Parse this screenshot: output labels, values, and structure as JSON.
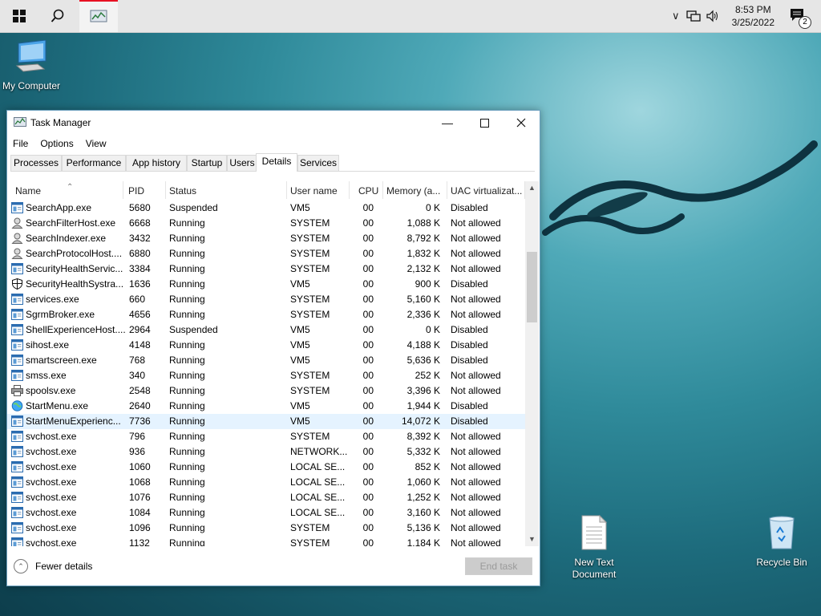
{
  "taskbar": {
    "start_icon": "windows-logo-icon",
    "search_icon": "search-icon",
    "active_app_icon": "task-manager-icon",
    "tray_chevron": "chevron-up-icon",
    "network_icon": "network-icon",
    "volume_icon": "volume-icon",
    "time": "8:53 PM",
    "date": "3/25/2022",
    "notifications_count": "2"
  },
  "desktop": {
    "icons": [
      {
        "label": "My Computer",
        "icon": "computer-icon"
      },
      {
        "label": "New Text Document",
        "label_line1": "New Text",
        "label_line2": "Document",
        "icon": "text-file-icon"
      },
      {
        "label": "Recycle Bin",
        "icon": "recycle-bin-icon"
      }
    ]
  },
  "window": {
    "title": "Task Manager",
    "menu": [
      "File",
      "Options",
      "View"
    ],
    "tabs": [
      "Processes",
      "Performance",
      "App history",
      "Startup",
      "Users",
      "Details",
      "Services"
    ],
    "active_tab": "Details",
    "columns": [
      "Name",
      "PID",
      "Status",
      "User name",
      "CPU",
      "Memory (a...",
      "UAC virtualizat..."
    ],
    "rows": [
      {
        "name": "SearchApp.exe",
        "pid": "5680",
        "status": "Suspended",
        "user": "VM5",
        "cpu": "00",
        "mem": "0 K",
        "uac": "Disabled",
        "icon": "app"
      },
      {
        "name": "SearchFilterHost.exe",
        "pid": "6668",
        "status": "Running",
        "user": "SYSTEM",
        "cpu": "00",
        "mem": "1,088 K",
        "uac": "Not allowed",
        "icon": "search"
      },
      {
        "name": "SearchIndexer.exe",
        "pid": "3432",
        "status": "Running",
        "user": "SYSTEM",
        "cpu": "00",
        "mem": "8,792 K",
        "uac": "Not allowed",
        "icon": "search"
      },
      {
        "name": "SearchProtocolHost....",
        "pid": "6880",
        "status": "Running",
        "user": "SYSTEM",
        "cpu": "00",
        "mem": "1,832 K",
        "uac": "Not allowed",
        "icon": "search"
      },
      {
        "name": "SecurityHealthServic...",
        "pid": "3384",
        "status": "Running",
        "user": "SYSTEM",
        "cpu": "00",
        "mem": "2,132 K",
        "uac": "Not allowed",
        "icon": "app"
      },
      {
        "name": "SecurityHealthSystra...",
        "pid": "1636",
        "status": "Running",
        "user": "VM5",
        "cpu": "00",
        "mem": "900 K",
        "uac": "Disabled",
        "icon": "shield"
      },
      {
        "name": "services.exe",
        "pid": "660",
        "status": "Running",
        "user": "SYSTEM",
        "cpu": "00",
        "mem": "5,160 K",
        "uac": "Not allowed",
        "icon": "app"
      },
      {
        "name": "SgrmBroker.exe",
        "pid": "4656",
        "status": "Running",
        "user": "SYSTEM",
        "cpu": "00",
        "mem": "2,336 K",
        "uac": "Not allowed",
        "icon": "app"
      },
      {
        "name": "ShellExperienceHost....",
        "pid": "2964",
        "status": "Suspended",
        "user": "VM5",
        "cpu": "00",
        "mem": "0 K",
        "uac": "Disabled",
        "icon": "app"
      },
      {
        "name": "sihost.exe",
        "pid": "4148",
        "status": "Running",
        "user": "VM5",
        "cpu": "00",
        "mem": "4,188 K",
        "uac": "Disabled",
        "icon": "app"
      },
      {
        "name": "smartscreen.exe",
        "pid": "768",
        "status": "Running",
        "user": "VM5",
        "cpu": "00",
        "mem": "5,636 K",
        "uac": "Disabled",
        "icon": "app"
      },
      {
        "name": "smss.exe",
        "pid": "340",
        "status": "Running",
        "user": "SYSTEM",
        "cpu": "00",
        "mem": "252 K",
        "uac": "Not allowed",
        "icon": "app"
      },
      {
        "name": "spoolsv.exe",
        "pid": "2548",
        "status": "Running",
        "user": "SYSTEM",
        "cpu": "00",
        "mem": "3,396 K",
        "uac": "Not allowed",
        "icon": "printer"
      },
      {
        "name": "StartMenu.exe",
        "pid": "2640",
        "status": "Running",
        "user": "VM5",
        "cpu": "00",
        "mem": "1,944 K",
        "uac": "Disabled",
        "icon": "globe"
      },
      {
        "name": "StartMenuExperienc...",
        "pid": "7736",
        "status": "Running",
        "user": "VM5",
        "cpu": "00",
        "mem": "14,072 K",
        "uac": "Disabled",
        "icon": "app",
        "selected": true
      },
      {
        "name": "svchost.exe",
        "pid": "796",
        "status": "Running",
        "user": "SYSTEM",
        "cpu": "00",
        "mem": "8,392 K",
        "uac": "Not allowed",
        "icon": "app"
      },
      {
        "name": "svchost.exe",
        "pid": "936",
        "status": "Running",
        "user": "NETWORK...",
        "cpu": "00",
        "mem": "5,332 K",
        "uac": "Not allowed",
        "icon": "app"
      },
      {
        "name": "svchost.exe",
        "pid": "1060",
        "status": "Running",
        "user": "LOCAL SE...",
        "cpu": "00",
        "mem": "852 K",
        "uac": "Not allowed",
        "icon": "app"
      },
      {
        "name": "svchost.exe",
        "pid": "1068",
        "status": "Running",
        "user": "LOCAL SE...",
        "cpu": "00",
        "mem": "1,060 K",
        "uac": "Not allowed",
        "icon": "app"
      },
      {
        "name": "svchost.exe",
        "pid": "1076",
        "status": "Running",
        "user": "LOCAL SE...",
        "cpu": "00",
        "mem": "1,252 K",
        "uac": "Not allowed",
        "icon": "app"
      },
      {
        "name": "svchost.exe",
        "pid": "1084",
        "status": "Running",
        "user": "LOCAL SE...",
        "cpu": "00",
        "mem": "3,160 K",
        "uac": "Not allowed",
        "icon": "app"
      },
      {
        "name": "svchost.exe",
        "pid": "1096",
        "status": "Running",
        "user": "SYSTEM",
        "cpu": "00",
        "mem": "5,136 K",
        "uac": "Not allowed",
        "icon": "app"
      },
      {
        "name": "svchost.exe",
        "pid": "1132",
        "status": "Running",
        "user": "SYSTEM",
        "cpu": "00",
        "mem": "1,184 K",
        "uac": "Not allowed",
        "icon": "app"
      }
    ],
    "fewer_details": "Fewer details",
    "end_task": "End task"
  },
  "colors": {
    "taskbar_bg": "#e6e6e6",
    "selected_row": "#e5f3ff",
    "window_border": "#6b9fbd"
  }
}
